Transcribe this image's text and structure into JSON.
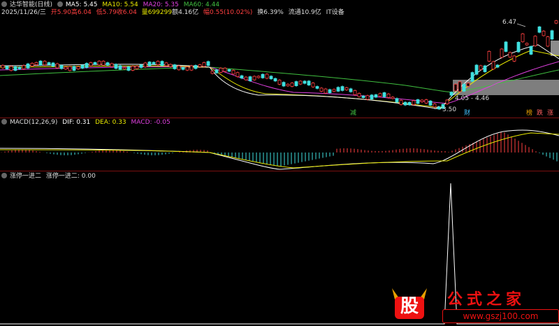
{
  "header": {
    "title": "达华智能(日线)",
    "ma5": "MA5: 5.45",
    "ma10": "MA10: 5.54",
    "ma20": "MA20: 5.35",
    "ma60": "MA60: 4.44"
  },
  "quote": {
    "date": "2025/11/26/三",
    "open": "开5.90",
    "high": "高6.04",
    "low": "低5.79",
    "close": "收6.04",
    "volume": "量699299",
    "amount": "额4.16亿",
    "change": "幅0.55(10.02%)",
    "turnover": "换6.39%",
    "float_cap": "流通10.9亿",
    "sector": "IT设备"
  },
  "annotations": {
    "high_price": "6.47",
    "low_price": "3.50",
    "range": "4.05 - 4.46",
    "tag_jian": "减",
    "tag_cai": "财",
    "tag_bang": "榜",
    "tag_die": "跌",
    "tag_zhang": "涨"
  },
  "macd": {
    "label": "MACD(12,26,9)",
    "dif": "DIF: 0.31",
    "dea": "DEA: 0.33",
    "macd": "MACD: -0.05"
  },
  "indicator": {
    "name": "涨停一进二",
    "value": "涨停一进二: 0.00"
  },
  "watermark": {
    "logo_char": "股",
    "title": "公式之家",
    "url": "www.gszj100.com"
  },
  "colors": {
    "ma5": "#ffffff",
    "ma10": "#e8e800",
    "ma20": "#e040e0",
    "ma60": "#40c040",
    "up": "#ff4040",
    "down": "#40e0e0",
    "border": "#7a1010",
    "watermark": "#e11111"
  }
}
